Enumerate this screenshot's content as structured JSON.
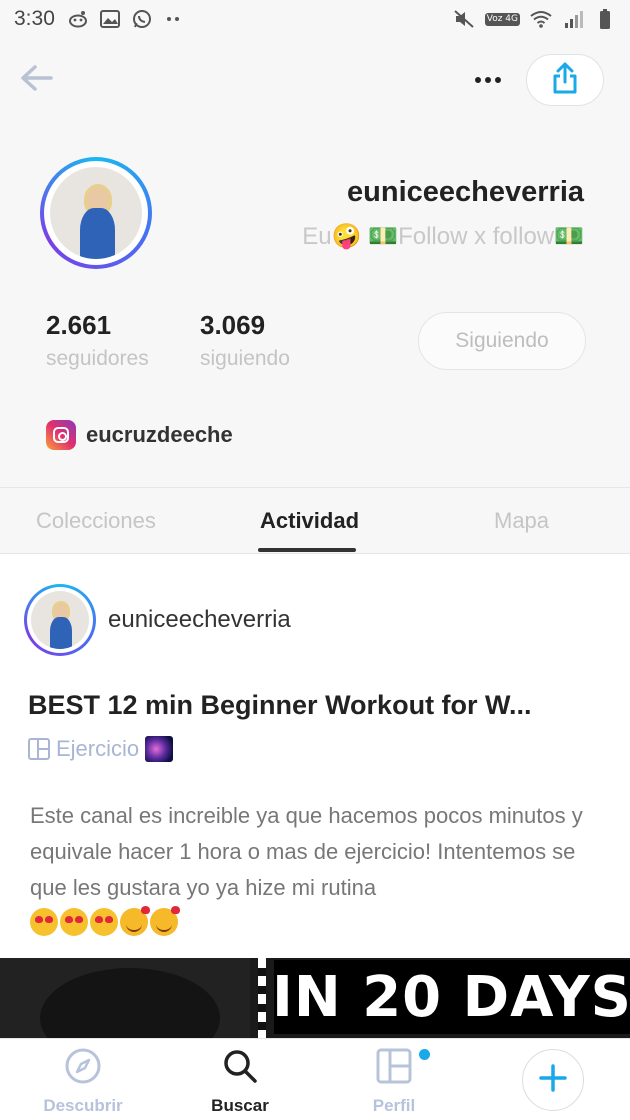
{
  "status_bar": {
    "time": "3:30",
    "left_icons": [
      "reddit-icon",
      "image-icon",
      "whatsapp-icon",
      "more-dots-icon"
    ],
    "right_icons": [
      "mute-icon",
      "volte-icon",
      "wifi-icon",
      "signal-icon",
      "battery-icon"
    ],
    "volte_label": "Voz 4G"
  },
  "header": {
    "back_icon": "arrow-left-icon",
    "more_icon": "more-horizontal-icon",
    "share_icon": "share-icon"
  },
  "profile": {
    "username": "euniceecheverria",
    "bio": "Eu🤪 💵Follow x follow💵",
    "followers_count": "2.661",
    "followers_label": "seguidores",
    "following_count": "3.069",
    "following_label": "siguiendo",
    "follow_button_label": "Siguiendo",
    "instagram_handle": "eucruzdeeche"
  },
  "tabs": {
    "items": [
      {
        "label": "Colecciones",
        "active": false
      },
      {
        "label": "Actividad",
        "active": true
      },
      {
        "label": "Mapa",
        "active": false
      }
    ]
  },
  "post": {
    "author": "euniceecheverria",
    "title": "BEST 12 min Beginner Workout for W...",
    "collection": "Ejercicio",
    "body": "Este canal es increible ya que hacemos pocos minutos y equivale hacer 1 hora o mas de ejercicio! Intentemos se que les gustara yo ya hize mi rutina",
    "emojis": "😍😍😍🥰🥰",
    "thumbnail_text": "IN 20 DAYS"
  },
  "bottom_nav": {
    "items": [
      {
        "label": "Descubrir",
        "icon": "compass-icon"
      },
      {
        "label": "Buscar",
        "icon": "search-icon",
        "active": true
      },
      {
        "label": "Perfil",
        "icon": "layout-icon"
      }
    ],
    "add_icon": "plus-icon"
  },
  "colors": {
    "accent": "#1aa9e8",
    "text_dark": "#222222",
    "muted": "#c5c5c5",
    "collection_link": "#a9b6d3"
  }
}
